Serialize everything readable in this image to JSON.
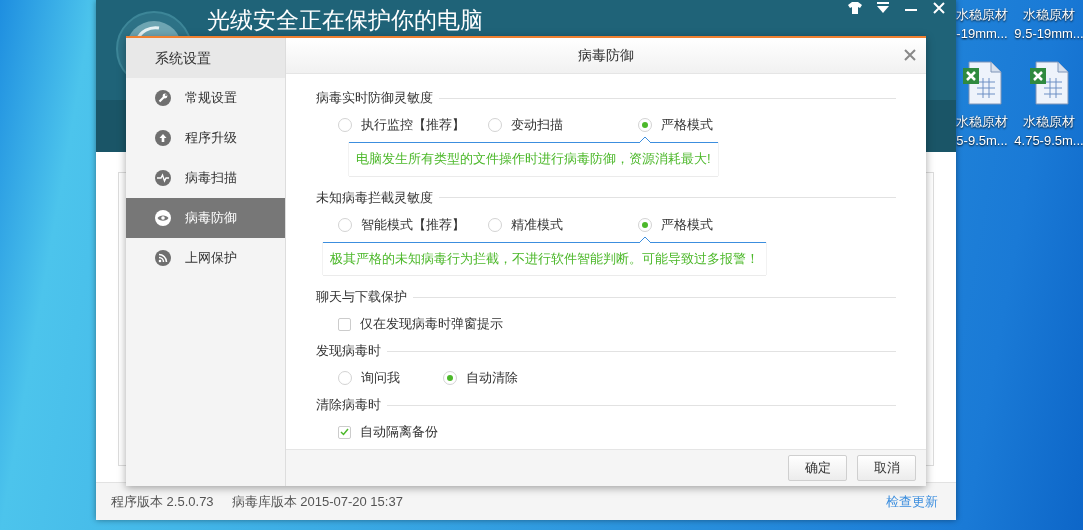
{
  "desktop_icons": [
    {
      "lines": [
        "水稳原材",
        "-19mm..."
      ],
      "file": false
    },
    {
      "lines": [
        "水稳原材",
        "9.5-19mm..."
      ],
      "file": false
    },
    {
      "lines": [
        "水稳原材",
        "5-9.5m..."
      ],
      "file": true
    },
    {
      "lines": [
        "水稳原材",
        "4.75-9.5m..."
      ],
      "file": true
    }
  ],
  "app": {
    "title": "光绒安全正在保护你的电脑",
    "footer": {
      "program_version": "程序版本 2.5.0.73",
      "db_version": "病毒库版本 2015-07-20 15:37",
      "update_link": "检查更新"
    }
  },
  "dialog": {
    "sidebar_title": "系统设置",
    "sidebar": [
      {
        "label": "常规设置",
        "selected": false
      },
      {
        "label": "程序升级",
        "selected": false
      },
      {
        "label": "病毒扫描",
        "selected": false
      },
      {
        "label": "病毒防御",
        "selected": true
      },
      {
        "label": "上网保护",
        "selected": false
      }
    ],
    "title": "病毒防御",
    "sections": [
      {
        "heading": "病毒实时防御灵敏度",
        "kind": "radio",
        "options": [
          {
            "label": "执行监控【推荐】",
            "selected": false
          },
          {
            "label": "变动扫描",
            "selected": false
          },
          {
            "label": "严格模式",
            "selected": true
          }
        ],
        "hint": "电脑发生所有类型的文件操作时进行病毒防御，资源消耗最大!"
      },
      {
        "heading": "未知病毒拦截灵敏度",
        "kind": "radio",
        "options": [
          {
            "label": "智能模式【推荐】",
            "selected": false
          },
          {
            "label": "精准模式",
            "selected": false
          },
          {
            "label": "严格模式",
            "selected": true
          }
        ],
        "hint": "极其严格的未知病毒行为拦截，不进行软件智能判断。可能导致过多报警！"
      },
      {
        "heading": "聊天与下载保护",
        "kind": "checkbox",
        "options": [
          {
            "label": "仅在发现病毒时弹窗提示",
            "checked": false
          }
        ]
      },
      {
        "heading": "发现病毒时",
        "kind": "radio",
        "options": [
          {
            "label": "询问我",
            "selected": false
          },
          {
            "label": "自动清除",
            "selected": true
          }
        ]
      },
      {
        "heading": "清除病毒时",
        "kind": "checkbox",
        "options": [
          {
            "label": "自动隔离备份",
            "checked": true
          }
        ]
      }
    ],
    "buttons": [
      "确定",
      "取消"
    ]
  }
}
